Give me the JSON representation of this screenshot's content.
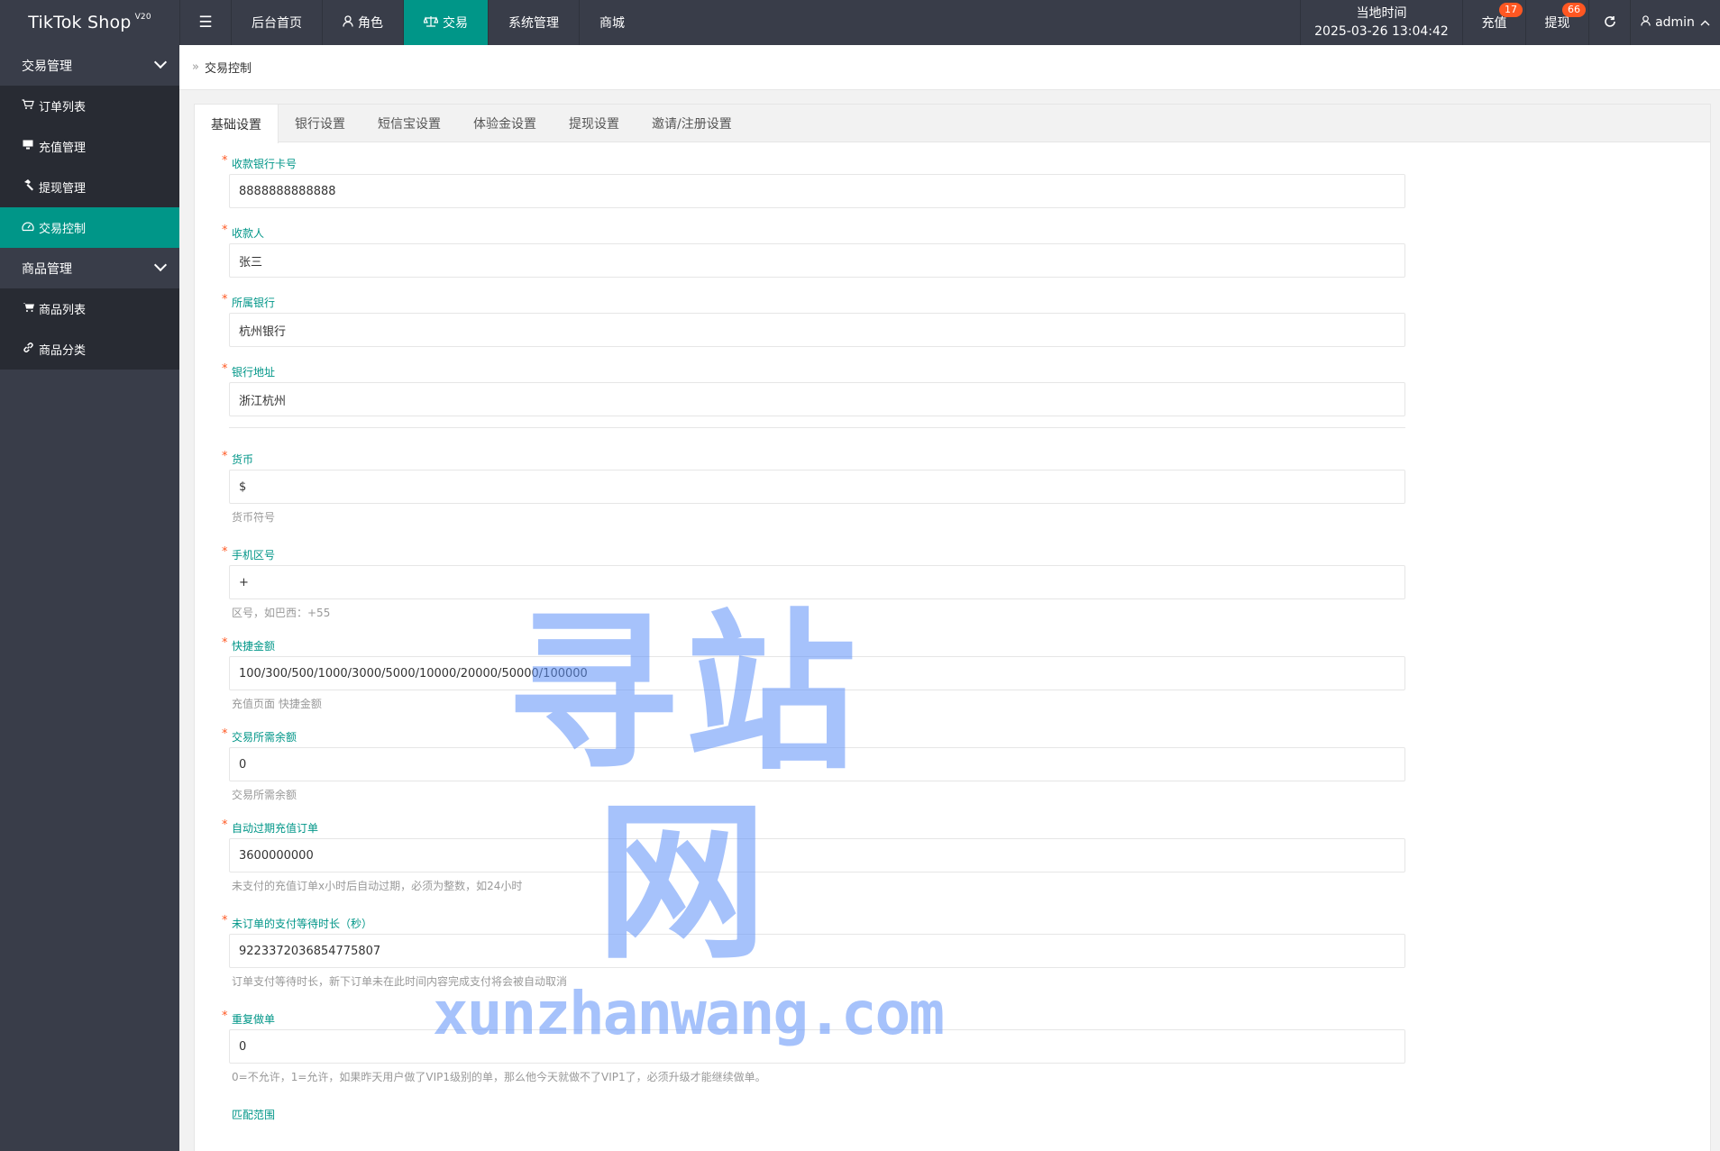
{
  "app": {
    "brand": "TikTok Shop",
    "version": "V20"
  },
  "topnav": {
    "menu_toggle_icon": "menu-icon",
    "items": [
      {
        "label": "后台首页",
        "icon": ""
      },
      {
        "label": "角色",
        "icon": "user-icon"
      },
      {
        "label": "交易",
        "icon": "scale-icon",
        "active": true
      },
      {
        "label": "系统管理",
        "icon": ""
      },
      {
        "label": "商城",
        "icon": ""
      }
    ]
  },
  "topright": {
    "clock_label": "当地时间",
    "clock_time": "2025-03-26 13:04:42",
    "recharge_label": "充值",
    "recharge_badge": "17",
    "withdraw_label": "提现",
    "withdraw_badge": "66",
    "refresh_icon": "refresh-icon",
    "user_label": "admin"
  },
  "sidebar": {
    "groups": [
      {
        "label": "交易管理",
        "items": [
          {
            "label": "订单列表",
            "icon": "cart-icon"
          },
          {
            "label": "充值管理",
            "icon": "monitor-icon"
          },
          {
            "label": "提现管理",
            "icon": "hammer-icon"
          },
          {
            "label": "交易控制",
            "icon": "gauge-icon",
            "active": true
          }
        ]
      },
      {
        "label": "商品管理",
        "items": [
          {
            "label": "商品列表",
            "icon": "cart-icon"
          },
          {
            "label": "商品分类",
            "icon": "link-icon"
          }
        ]
      }
    ]
  },
  "breadcrumb": {
    "current": "交易控制"
  },
  "tabs": [
    {
      "label": "基础设置",
      "active": true
    },
    {
      "label": "银行设置"
    },
    {
      "label": "短信宝设置"
    },
    {
      "label": "体验金设置"
    },
    {
      "label": "提现设置"
    },
    {
      "label": "邀请/注册设置"
    }
  ],
  "form": {
    "fields": [
      {
        "label": "收款银行卡号",
        "value": "8888888888888",
        "hint": ""
      },
      {
        "label": "收款人",
        "value": "张三",
        "hint": ""
      },
      {
        "label": "所属银行",
        "value": "杭州银行",
        "hint": ""
      },
      {
        "label": "银行地址",
        "value": "浙江杭州",
        "hint": ""
      },
      {
        "label": "货币",
        "value": "$",
        "hint": "货币符号"
      },
      {
        "label": "手机区号",
        "value": "+",
        "hint": "区号，如巴西：+55"
      },
      {
        "label": "快捷金额",
        "value": "100/300/500/1000/3000/5000/10000/20000/50000/100000",
        "hint": "充值页面 快捷金额"
      },
      {
        "label": "交易所需余额",
        "value": "0",
        "hint": "交易所需余额"
      },
      {
        "label": "自动过期充值订单",
        "value": "3600000000",
        "hint": "未支付的充值订单x小时后自动过期，必须为整数，如24小时"
      },
      {
        "label": "未订单的支付等待时长（秒）",
        "value": "9223372036854775807",
        "hint": "订单支付等待时长，新下订单未在此时间内容完成支付将会被自动取消"
      },
      {
        "label": "重复做单",
        "value": "0",
        "hint": "0=不允许，1=允许，如果昨天用户做了VIP1级别的单，那么他今天就做不了VIP1了，必须升级才能继续做单。"
      },
      {
        "label": "匹配范围",
        "value": "",
        "hint": ""
      }
    ]
  },
  "watermark": {
    "title": "寻站网",
    "url": "xunzhanwang.com"
  },
  "colors": {
    "topbar": "#393d49",
    "accent": "#009688",
    "badge": "#ff5722",
    "label": "#009688"
  }
}
